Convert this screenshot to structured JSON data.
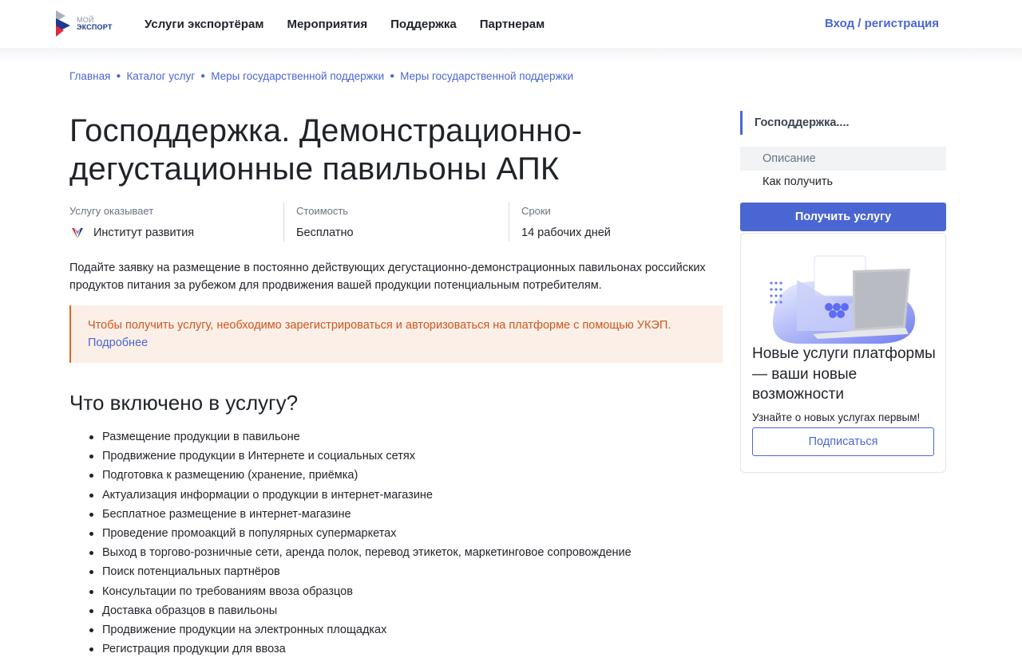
{
  "header": {
    "logo": {
      "line1": "МОЙ",
      "line2": "ЭКСПОРТ",
      "icon": "moy-export-logo"
    },
    "nav": [
      "Услуги экспортёрам",
      "Мероприятия",
      "Поддержка",
      "Партнерам"
    ],
    "login_label": "Вход / регистрация"
  },
  "breadcrumb": [
    "Главная",
    "Каталог услуг",
    "Меры государственной поддержки",
    "Меры государственной поддержки"
  ],
  "page": {
    "title": "Господдержка. Демонстрационно-дегустационные павильоны АПК",
    "provider_label": "Услугу оказывает",
    "provider_value": "Институт развития",
    "cost_label": "Стоимость",
    "cost_value": "Бесплатно",
    "term_label": "Сроки",
    "term_value": "14 рабочих дней",
    "description": "Подайте заявку на размещение в постоянно действующих дегустационно-демонстрационных павильонах российских продуктов питания за рубежом для продвижения вашей продукции потенциальным потребителям.",
    "notice_text": "Чтобы получить услугу, необходимо зарегистрироваться и авторизоваться на платформе с помощью УКЭП.",
    "notice_link": "Подробнее",
    "section_title": "Что включено в услугу?",
    "included": [
      "Размещение продукции в павильоне",
      "Продвижение продукции в Интернете и социальных сетях",
      "Подготовка к размещению (хранение, приёмка)",
      "Актуализация информации о продукции в интернет-магазине",
      "Бесплатное размещение в интернет-магазине",
      "Проведение промоакций в популярных супермаркетах",
      "Выход в торгово-розничные сети, аренда полок, перевод этикеток, маркетинговое сопровождение",
      "Поиск потенциальных партнёров",
      "Консультации по требованиям ввоза образцов",
      "Доставка образцов в павильоны",
      "Продвижение продукции на электронных площадках",
      "Регистрация продукции для ввоза"
    ]
  },
  "sidebar": {
    "active_title": "Господдержка....",
    "items": [
      "Описание",
      "Как получить"
    ],
    "cta_label": "Получить услугу",
    "promo": {
      "title": "Новые услуги платформы — ваши новые возможности",
      "subtitle": "Узнайте о новых услугах первым!",
      "button_label": "Подписаться"
    }
  },
  "colors": {
    "accent": "#4a66d3",
    "notice_bg": "#fcefe7",
    "notice_text": "#d0561c"
  }
}
